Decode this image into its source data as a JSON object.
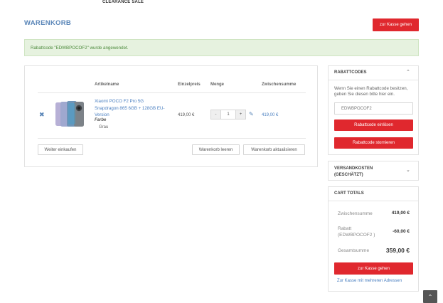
{
  "nav": {
    "clearance": "CLEARANCE SALE"
  },
  "page": {
    "title": "WARENKORB",
    "checkout_top": "zur Kasse gehen"
  },
  "alert": {
    "text": "Rabattcode \"EDWBPOCOF2\" wurde angewendet."
  },
  "table": {
    "headers": {
      "name": "Artikelname",
      "price": "Einzelpreis",
      "qty": "Menge",
      "subtotal": "Zwischensumme"
    },
    "item": {
      "name": "Xiaomi POCO F2 Pro 5G Snapdragon 865 6GB + 128GB EU-Version",
      "option_label": "Farbe",
      "option_value": "Grau",
      "price": "419,00 €",
      "qty": "1",
      "qty_minus": "-",
      "qty_plus": "+",
      "subtotal": "419,00 €",
      "remove_icon": "close-icon",
      "edit_icon": "pencil-icon"
    },
    "buttons": {
      "continue": "Weiter einkaufen",
      "clear": "Warenkorb leeren",
      "update": "Warenkorb aktualisieren"
    }
  },
  "coupon": {
    "heading": "RABATTCODES",
    "text": "Wenn Sie einen Rabattcode besitzen, geben Sie diesen bitte hier ein.",
    "code_value": "EDWBPOCOF2",
    "apply": "Rabattcode einlösen",
    "cancel": "Rabattcode stornieren"
  },
  "shipping": {
    "heading": "VERSANDKOSTEN (GESCHÄTZT)"
  },
  "totals": {
    "heading": "CART TOTALS",
    "subtotal_label": "Zwischensumme",
    "subtotal_value": "419,00 €",
    "discount_label": "Rabatt (EDWBPOCOF2 )",
    "discount_value": "-60,00 €",
    "grand_label": "Gesamtsumme",
    "grand_value": "359,00 €",
    "checkout": "zur Kasse gehen",
    "multi_address": "Zur Kasse mit mehreren Adressen"
  },
  "colors": {
    "accent": "#e0282e",
    "link": "#4a7fc0",
    "title": "#5a86b8",
    "success_bg": "#e6f2df"
  }
}
